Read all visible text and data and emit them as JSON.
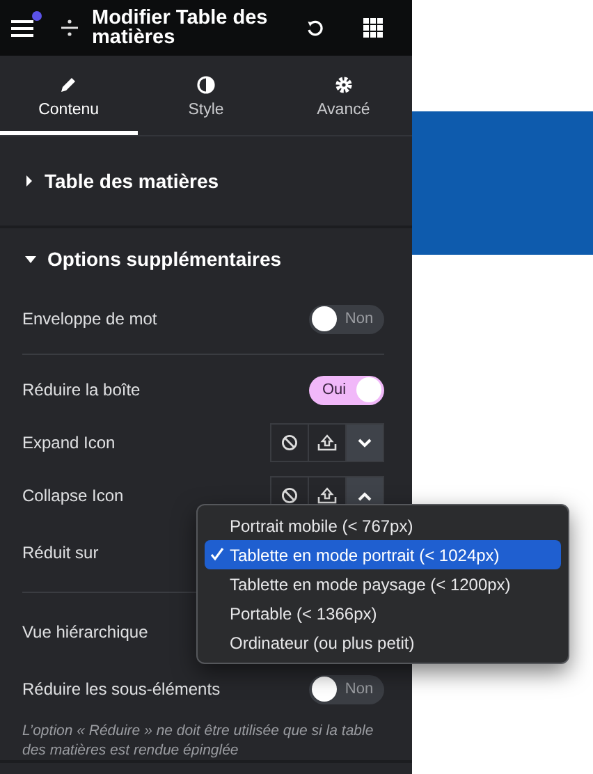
{
  "header": {
    "title": "Modifier Table des matières",
    "notification": true
  },
  "tabs": [
    {
      "label": "Contenu",
      "selected": true
    },
    {
      "label": "Style",
      "selected": false
    },
    {
      "label": "Avancé",
      "selected": false
    }
  ],
  "sections": [
    {
      "title": "Table des matières",
      "expanded": false
    },
    {
      "title": "Options supplémentaires",
      "expanded": true,
      "controls": [
        {
          "kind": "switch",
          "label": "Enveloppe de mot",
          "on": false,
          "state_label": "Non",
          "divider_after": true
        },
        {
          "kind": "switch",
          "label": "Réduire la boîte",
          "on": true,
          "state_label": "Oui"
        },
        {
          "kind": "icons",
          "label": "Expand Icon",
          "open": false
        },
        {
          "kind": "icons",
          "label": "Collapse Icon",
          "open": true
        },
        {
          "kind": "label",
          "label": "Réduit sur",
          "divider_after": true
        },
        {
          "kind": "label",
          "label": "Vue hiérarchique"
        },
        {
          "kind": "switch",
          "label": "Réduire les sous-éléments",
          "on": false,
          "state_label": "Non"
        },
        {
          "kind": "note",
          "label": "L’option « Réduire » ne doit être utilisée que si la table des matières est rendue épinglée"
        }
      ]
    }
  ],
  "dropdown": {
    "options": [
      {
        "label": "Portrait mobile (< 767px)",
        "selected": false
      },
      {
        "label": "Tablette en mode portrait (< 1024px)",
        "selected": true
      },
      {
        "label": "Tablette en mode paysage (< 1200px)",
        "selected": false
      },
      {
        "label": "Portable (< 1366px)",
        "selected": false
      },
      {
        "label": "Ordinateur (ou plus petit)",
        "selected": false
      }
    ]
  }
}
